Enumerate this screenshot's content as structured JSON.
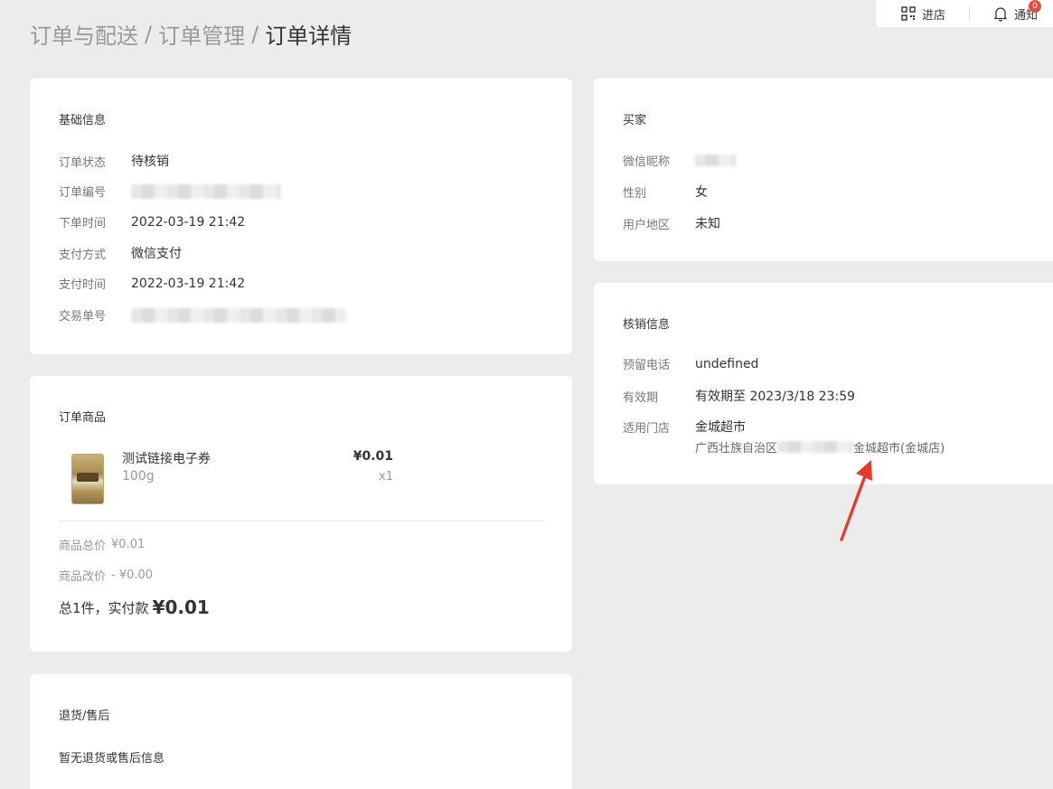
{
  "topbar": {
    "enter_store": "进店",
    "notify": "通知",
    "notify_badge": "0"
  },
  "breadcrumb": {
    "level1": "订单与配送",
    "level2": "订单管理",
    "current": "订单详情",
    "separator": "/"
  },
  "basic_info": {
    "title": "基础信息",
    "rows": [
      {
        "label": "订单状态",
        "value": "待核销"
      },
      {
        "label": "订单编号",
        "value": ""
      },
      {
        "label": "下单时间",
        "value": "2022-03-19 21:42"
      },
      {
        "label": "支付方式",
        "value": "微信支付"
      },
      {
        "label": "支付时间",
        "value": "2022-03-19 21:42"
      },
      {
        "label": "交易单号",
        "value": ""
      }
    ]
  },
  "order_goods": {
    "title": "订单商品",
    "product": {
      "name": "测试链接电子券",
      "spec": "100g",
      "price": "¥0.01",
      "qty": "x1"
    },
    "subtotal_label": "商品总价",
    "subtotal_value": "¥0.01",
    "adjust_label": "商品改价",
    "adjust_value": "- ¥0.00",
    "summary_prefix": "总1件，实付款",
    "summary_value": "¥0.01"
  },
  "after_sale": {
    "title": "退货/售后",
    "empty_text": "暂无退货或售后信息"
  },
  "buyer": {
    "title": "买家",
    "rows": [
      {
        "label": "微信昵称",
        "value": ""
      },
      {
        "label": "性别",
        "value": "女"
      },
      {
        "label": "用户地区",
        "value": "未知"
      }
    ]
  },
  "verify_info": {
    "title": "核销信息",
    "phone_label": "预留电话",
    "phone_value": "undefined",
    "expiry_label": "有效期",
    "expiry_value": "有效期至 2023/3/18 23:59",
    "store_label": "适用门店",
    "store_name": "金城超市",
    "address_prefix": "广西壮族自治区",
    "address_suffix": "金城超市(金城店)"
  },
  "colors": {
    "accent_red": "#e8392c",
    "page_bg": "#ececec",
    "card_bg": "#ffffff"
  }
}
